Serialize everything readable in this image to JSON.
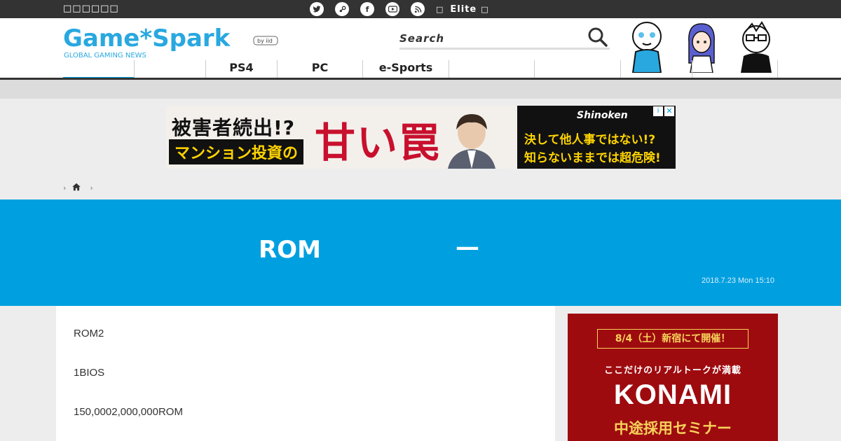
{
  "topbar": {
    "left_text": "□□□□□□",
    "social_icons": [
      "twitter-icon",
      "steam-icon",
      "facebook-icon",
      "youtube-icon",
      "rss-icon"
    ],
    "box_glyph_left": "□",
    "elite_label": "Elite",
    "box_glyph_right": "□"
  },
  "header": {
    "logo_main": "Game*Spark",
    "logo_tagline": "GLOBAL GAMING NEWS",
    "logo_badge": "by iid",
    "search_label": "Search"
  },
  "nav": {
    "items": [
      {
        "label": ""
      },
      {
        "label": ""
      },
      {
        "label": "PS4"
      },
      {
        "label": "PC"
      },
      {
        "label": "e-Sports"
      },
      {
        "label": ""
      },
      {
        "label": ""
      },
      {
        "label": ""
      },
      {
        "label": ""
      }
    ]
  },
  "banner_ad": {
    "line1": "被害者続出!?",
    "line2": "マンション投資の",
    "big": "甘い罠",
    "brand": "Shinoken",
    "right1": "決して他人事ではない!?",
    "right2": "知らないままでは超危険!",
    "info_glyph": "i",
    "close_glyph": "✕"
  },
  "breadcrumb": {
    "sep": "›"
  },
  "article": {
    "title_left": "ROM",
    "title_right": "—",
    "date": "2018.7.23 Mon 15:10",
    "paragraphs": [
      "ROM2",
      "1BIOS",
      "150,0002,000,000ROM"
    ]
  },
  "side_ad": {
    "date_line": "8/4（土）新宿にて開催！",
    "sub": "ここだけのリアルトークが満載",
    "brand": "KONAMI",
    "event": "中途採用セミナー"
  },
  "colors": {
    "accent": "#00a0e0",
    "dark": "#333333",
    "ad_red": "#9e0b0f"
  }
}
